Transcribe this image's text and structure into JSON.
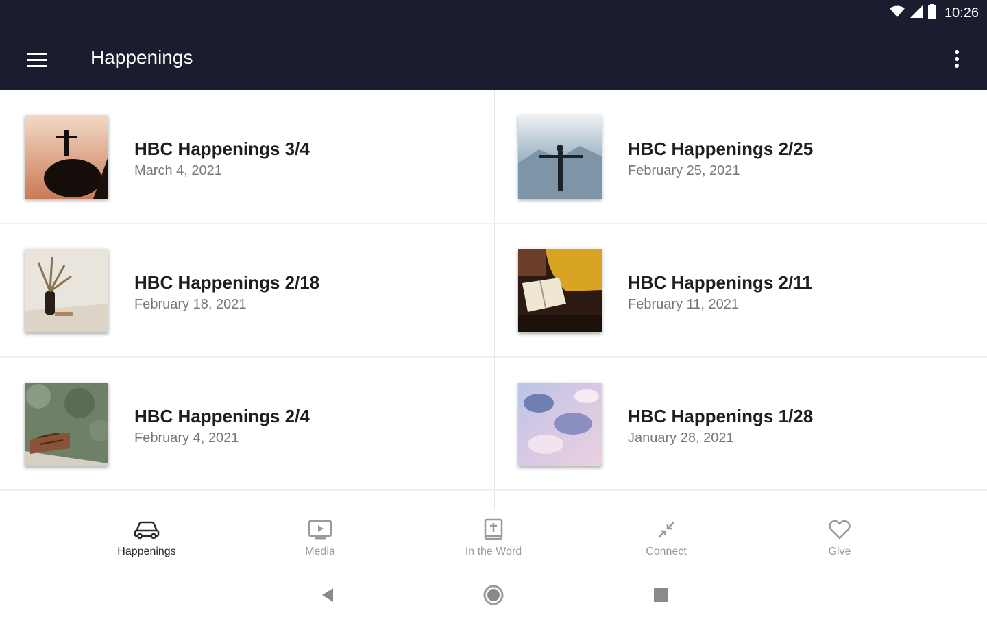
{
  "status_bar": {
    "time": "10:26",
    "icons": [
      "wifi-icon",
      "cell-signal-icon",
      "battery-icon"
    ]
  },
  "app_bar": {
    "title": "Happenings",
    "menu_icon": "hamburger-menu-icon",
    "overflow_icon": "more-vert-icon"
  },
  "items": [
    {
      "title": "HBC Happenings 3/4",
      "date": "March 4, 2021"
    },
    {
      "title": "HBC Happenings 2/25",
      "date": "February 25, 2021"
    },
    {
      "title": "HBC Happenings 2/18",
      "date": "February 18, 2021"
    },
    {
      "title": "HBC Happenings 2/11",
      "date": "February 11, 2021"
    },
    {
      "title": "HBC Happenings 2/4",
      "date": "February 4, 2021"
    },
    {
      "title": "HBC Happenings 1/28",
      "date": "January 28, 2021"
    }
  ],
  "bottom_nav": [
    {
      "label": "Happenings",
      "icon": "car-icon",
      "active": true
    },
    {
      "label": "Media",
      "icon": "tv-play-icon",
      "active": false
    },
    {
      "label": "In the Word",
      "icon": "bible-icon",
      "active": false
    },
    {
      "label": "Connect",
      "icon": "connect-arrows-icon",
      "active": false
    },
    {
      "label": "Give",
      "icon": "heart-icon",
      "active": false
    }
  ],
  "system_nav": [
    "back-icon",
    "home-icon",
    "recents-icon"
  ],
  "colors": {
    "bar_bg": "#1b1d2f",
    "active_label": "#2a2a2a",
    "inactive_label": "#9a9a9a"
  }
}
